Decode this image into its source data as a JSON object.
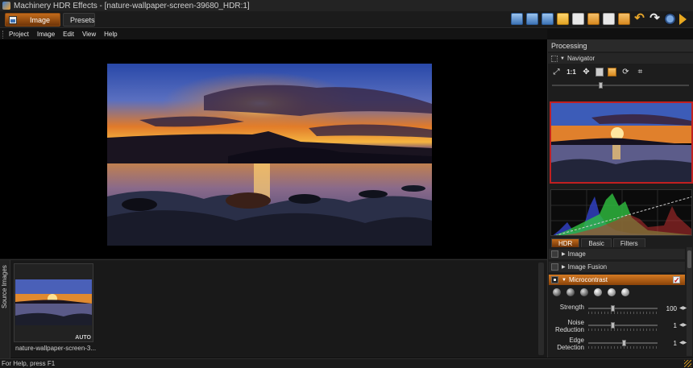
{
  "window": {
    "title": "Machinery HDR Effects - [nature-wallpaper-screen-39680_HDR:1]"
  },
  "toolbar": {
    "image_label": "Image",
    "presets_label": "Presets",
    "icons": [
      "monitor-icon",
      "save-icon",
      "save-as-icon",
      "open-folder-icon",
      "document-icon",
      "export-icon",
      "upload-icon",
      "batch-icon",
      "undo-icon",
      "redo-icon",
      "refresh-icon",
      "play-icon"
    ]
  },
  "menu": {
    "items": [
      "Project",
      "Image",
      "Edit",
      "View",
      "Help"
    ]
  },
  "sources": {
    "tab_label": "Source Images",
    "thumb_badge": "AUTO",
    "thumb_name": "nature-wallpaper-screen-3..."
  },
  "panel": {
    "title": "Processing",
    "navigator_label": "Navigator",
    "zoom_label": "1:1",
    "tabs": [
      "HDR",
      "Basic",
      "Filters"
    ],
    "active_tab": "HDR",
    "sections": {
      "image": "Image",
      "image_fusion": "Image Fusion",
      "microcontrast": "Microcontrast"
    },
    "microcontrast_enabled": true,
    "sliders": {
      "strength": {
        "label": "Strength",
        "value": "100",
        "level": 0.36
      },
      "noise": {
        "label_1": "Noise",
        "label_2": "Reduction",
        "value": "1",
        "level": 0.36
      },
      "edge": {
        "label_1": "Edge",
        "label_2": "Detection",
        "value": "1",
        "level": 0.52
      }
    }
  },
  "status": {
    "text": "For Help, press F1"
  },
  "colors": {
    "accent": "#c26a1a",
    "preview_border": "#c02020"
  }
}
